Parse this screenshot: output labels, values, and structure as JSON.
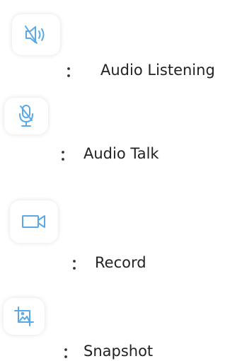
{
  "legend": {
    "items": [
      {
        "icon": "speaker-muted-icon",
        "colon": "：",
        "label": "Audio Listening"
      },
      {
        "icon": "microphone-icon",
        "colon": "：",
        "label": "Audio Talk"
      },
      {
        "icon": "video-camera-icon",
        "colon": "：",
        "label": "Record"
      },
      {
        "icon": "snapshot-image-icon",
        "colon": "：",
        "label": "Snapshot"
      }
    ]
  },
  "colors": {
    "icon_blue": "#5aa9e6"
  }
}
